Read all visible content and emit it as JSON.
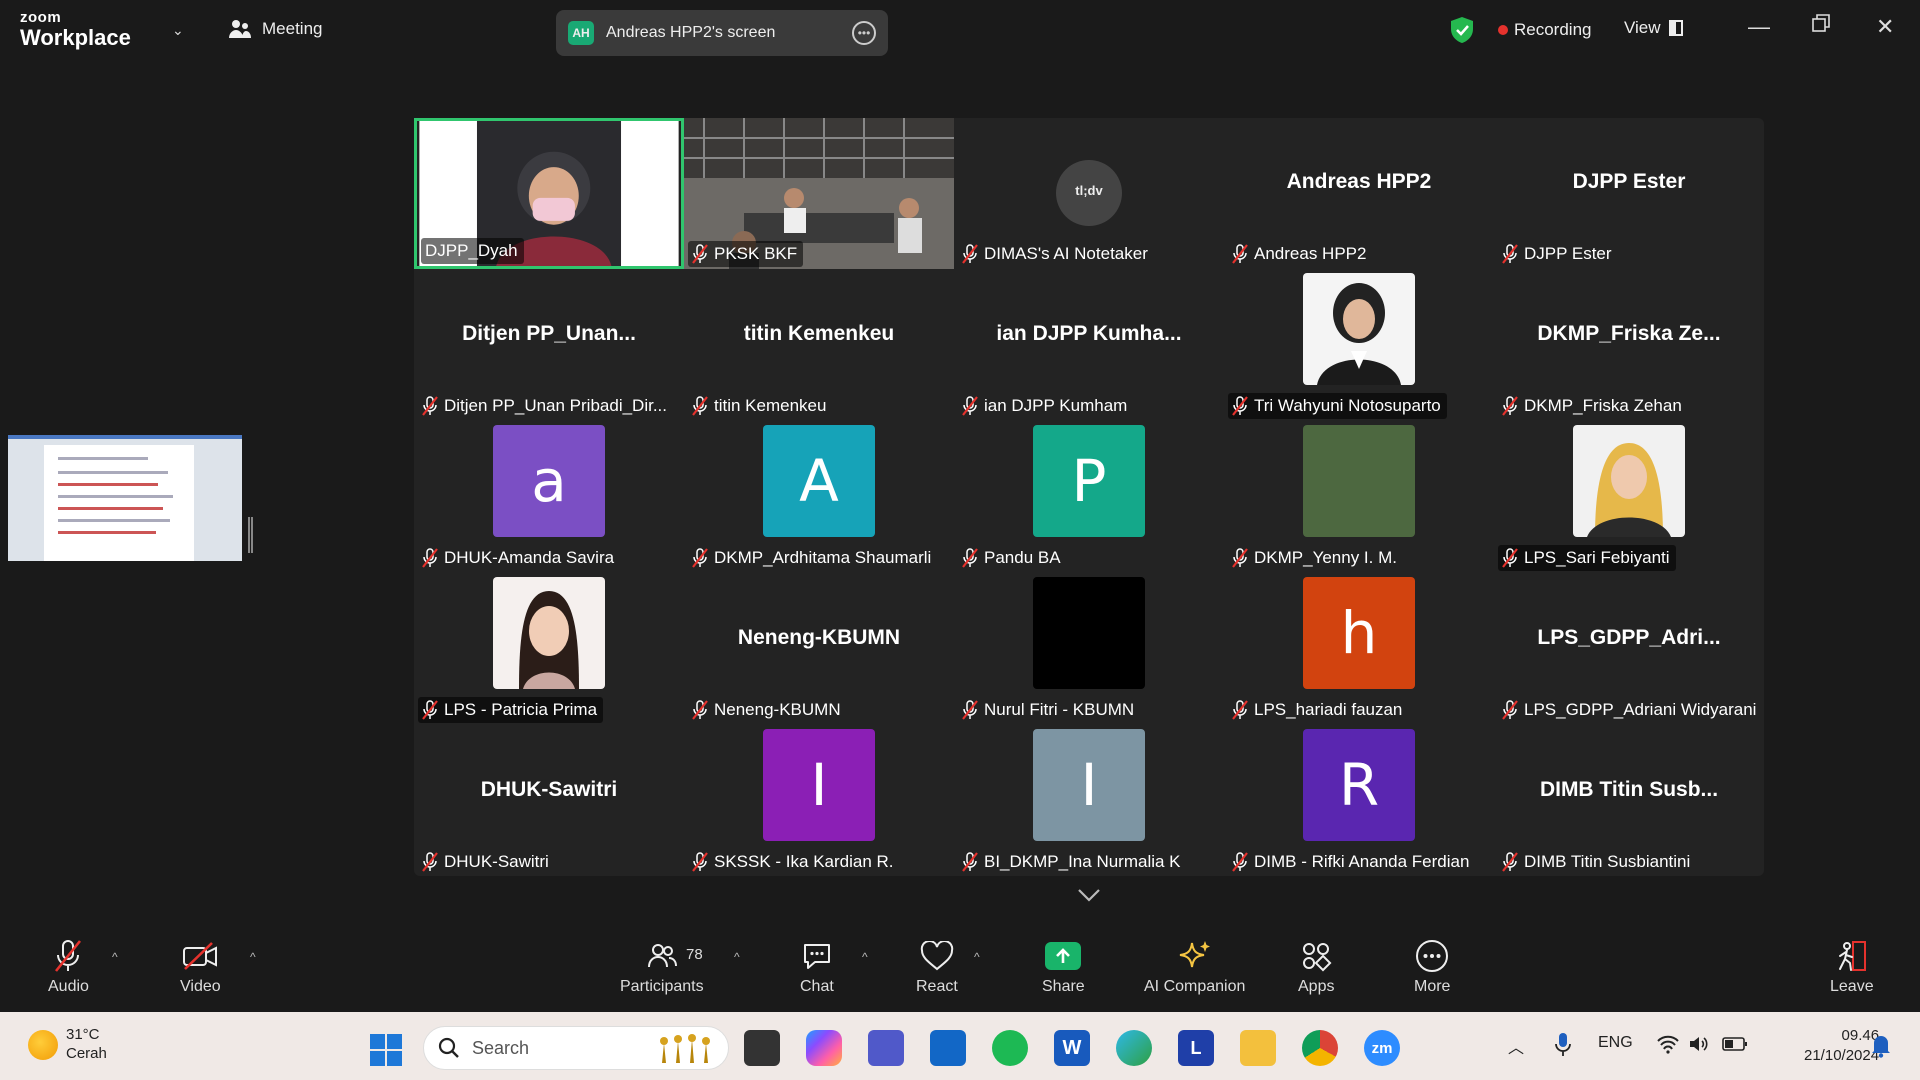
{
  "topbar": {
    "brand_small": "zoom",
    "brand_large": "Workplace",
    "meeting_label": "Meeting",
    "share_avatar_initials": "AH",
    "share_label": "Andreas HPP2's screen",
    "recording_label": "Recording",
    "view_label": "View"
  },
  "gallery": {
    "tiles": [
      {
        "label": "DJPP_Dyah",
        "type": "video",
        "active": true
      },
      {
        "label": "PKSK BKF",
        "type": "video"
      },
      {
        "label": "DIMAS's AI Notetaker",
        "type": "logo",
        "logo_text": "tl;dv"
      },
      {
        "label": "Andreas HPP2",
        "big_name": "Andreas HPP2"
      },
      {
        "label": "DJPP Ester",
        "big_name": "DJPP Ester"
      },
      {
        "label": "Ditjen PP_Unan Pribadi_Dir...",
        "big_name": "Ditjen  PP_Unan..."
      },
      {
        "label": "titin Kemenkeu",
        "big_name": "titin Kemenkeu"
      },
      {
        "label": "ian DJPP Kumham",
        "big_name": "ian DJPP Kumha..."
      },
      {
        "label": "Tri Wahyuni Notosuparto",
        "type": "photo"
      },
      {
        "label": "DKMP_Friska Zehan",
        "big_name": "DKMP_Friska  Ze..."
      },
      {
        "label": "DHUK-Amanda Savira",
        "avatar": "a",
        "color": "#7b4fc4"
      },
      {
        "label": "DKMP_Ardhitama Shaumarli",
        "avatar": "A",
        "color": "#16a3b8"
      },
      {
        "label": "Pandu BA",
        "avatar": "P",
        "color": "#14a88a"
      },
      {
        "label": "DKMP_Yenny I. M.",
        "avatar": "",
        "color": "#4d6840"
      },
      {
        "label": "LPS_Sari Febiyanti",
        "type": "photo"
      },
      {
        "label": "LPS - Patricia Prima",
        "type": "photo"
      },
      {
        "label": "Neneng-KBUMN",
        "big_name": "Neneng-KBUMN"
      },
      {
        "label": "Nurul Fitri - KBUMN",
        "avatar": "",
        "color": "#000000"
      },
      {
        "label": "LPS_hariadi fauzan",
        "avatar": "h",
        "color": "#d2430f"
      },
      {
        "label": "LPS_GDPP_Adriani Widyarani",
        "big_name": "LPS_GDPP_Adri..."
      },
      {
        "label": "DHUK-Sawitri",
        "big_name": "DHUK-Sawitri"
      },
      {
        "label": "SKSSK - Ika Kardian R.",
        "avatar": "I",
        "color": "#8b1fb5"
      },
      {
        "label": "BI_DKMP_Ina Nurmalia K",
        "avatar": "I",
        "color": "#7d95a3"
      },
      {
        "label": "DIMB - Rifki Ananda Ferdian",
        "avatar": "R",
        "color": "#5a26b0"
      },
      {
        "label": "DIMB Titin Susbiantini",
        "big_name": "DIMB  Titin  Susb..."
      }
    ]
  },
  "toolbar": {
    "audio": "Audio",
    "video": "Video",
    "participants": "Participants",
    "participants_count": "78",
    "chat": "Chat",
    "react": "React",
    "share": "Share",
    "ai_companion": "AI Companion",
    "apps": "Apps",
    "more": "More",
    "leave": "Leave"
  },
  "taskbar": {
    "temperature": "31°C",
    "weather": "Cerah",
    "search_placeholder": "Search",
    "language": "ENG",
    "time": "09.46",
    "date": "21/10/2024",
    "app_l": "L",
    "app_zoom": "zm"
  },
  "colors": {
    "active_border": "#30c66e",
    "recording": "#e5322d",
    "share_green": "#19b46a"
  }
}
